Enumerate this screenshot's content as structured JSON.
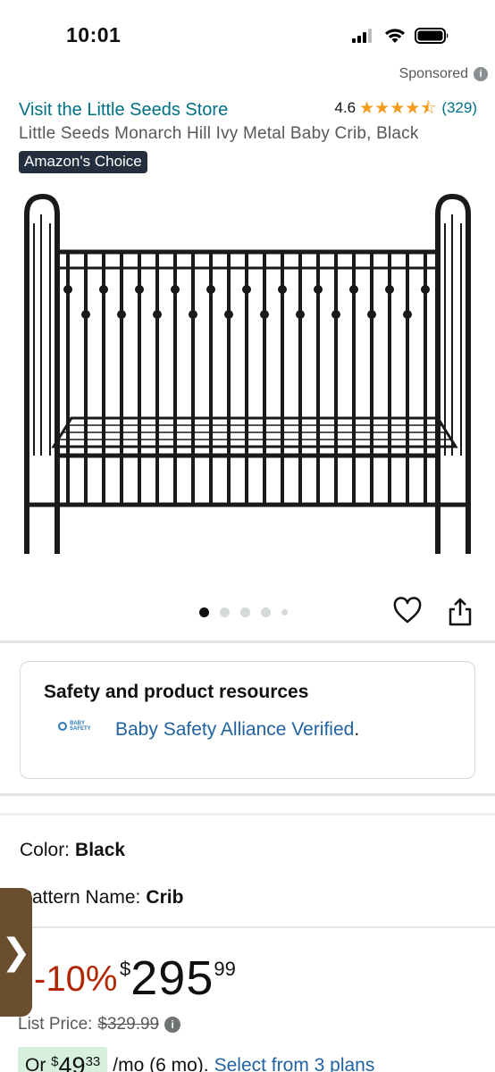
{
  "status_bar": {
    "time": "10:01",
    "icons": [
      "cellular-signal-icon",
      "wifi-icon",
      "battery-icon"
    ]
  },
  "sponsored": {
    "label": "Sponsored",
    "icon": "info-icon"
  },
  "header": {
    "store_link": "Visit the Little Seeds Store",
    "rating_value": "4.6",
    "stars": 4.6,
    "rating_count": "(329)",
    "title": "Little Seeds Monarch Hill Ivy Metal Baby Crib, Black",
    "badge": "Amazon's Choice"
  },
  "gallery": {
    "image_alt": "Black metal baby crib",
    "dot_count": 5,
    "active_index": 0
  },
  "actions": {
    "wishlist_icon": "heart-icon",
    "share_icon": "share-icon"
  },
  "resources": {
    "title": "Safety and product resources",
    "logo_text": "BABY SAFETY ALLIANCE",
    "link_text": "Baby Safety Alliance Verified",
    "link_suffix": "."
  },
  "variations": {
    "color_label": "Color:",
    "color_value": "Black",
    "pattern_label": "Pattern Name:",
    "pattern_value": "Crib"
  },
  "side_tab": {
    "chevron": "❯"
  },
  "pricing": {
    "discount": "-10%",
    "currency": "$",
    "whole": "295",
    "fraction": "99",
    "list_price_label": "List Price:",
    "list_price_value": "$329.99",
    "monthly_prefix": "Or ",
    "monthly_currency": "$",
    "monthly_whole": "49",
    "monthly_fraction": "33",
    "monthly_suffix": "/mo (6 mo).",
    "monthly_link": "Select from 3 plans"
  },
  "colors": {
    "link": "#007185",
    "price_discount": "#b12704",
    "star": "#f29b1d",
    "badge_bg": "#232f3e"
  }
}
